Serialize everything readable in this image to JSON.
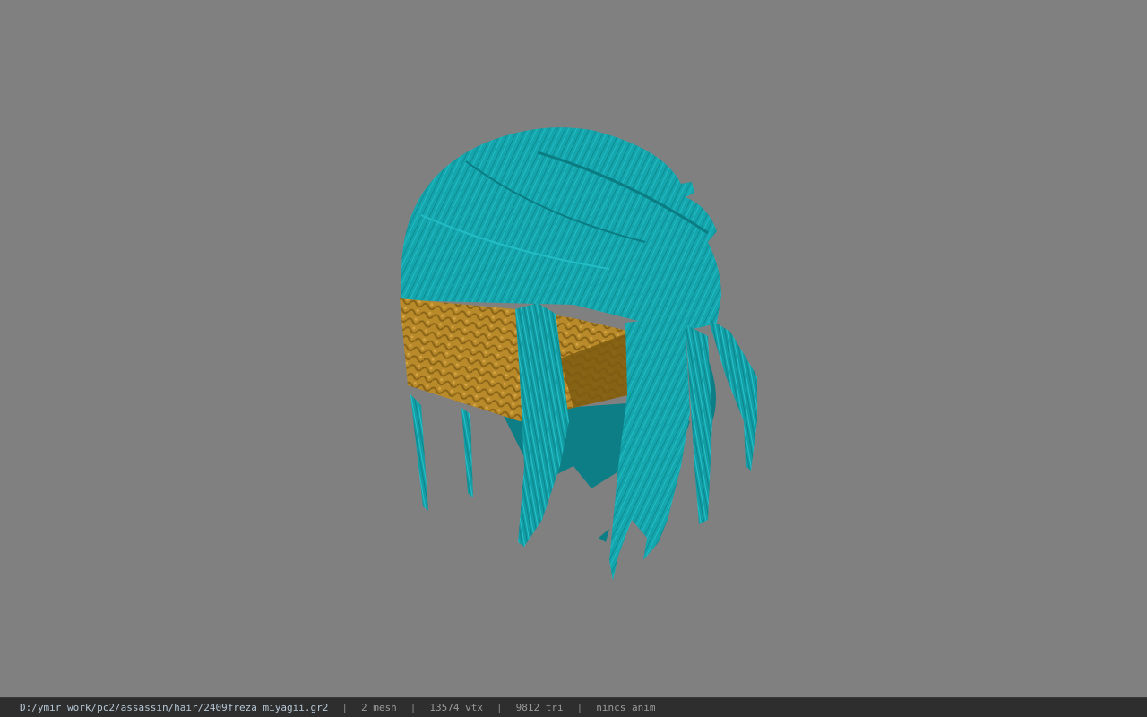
{
  "viewer": {
    "background_color": "#808080",
    "model": {
      "hair_color": "#14a5ad",
      "hair_dark": "#0d7e85",
      "band_color": "#b98a2a",
      "band_dark": "#7d5a10"
    }
  },
  "statusbar": {
    "file_path": "D:/ymir work/pc2/assassin/hair/2409freza_miyagii.gr2",
    "separator": "|",
    "mesh_count": "2 mesh",
    "vertex_count": "13574 vtx",
    "triangle_count": "9812 tri",
    "anim_status": "nincs anim"
  }
}
